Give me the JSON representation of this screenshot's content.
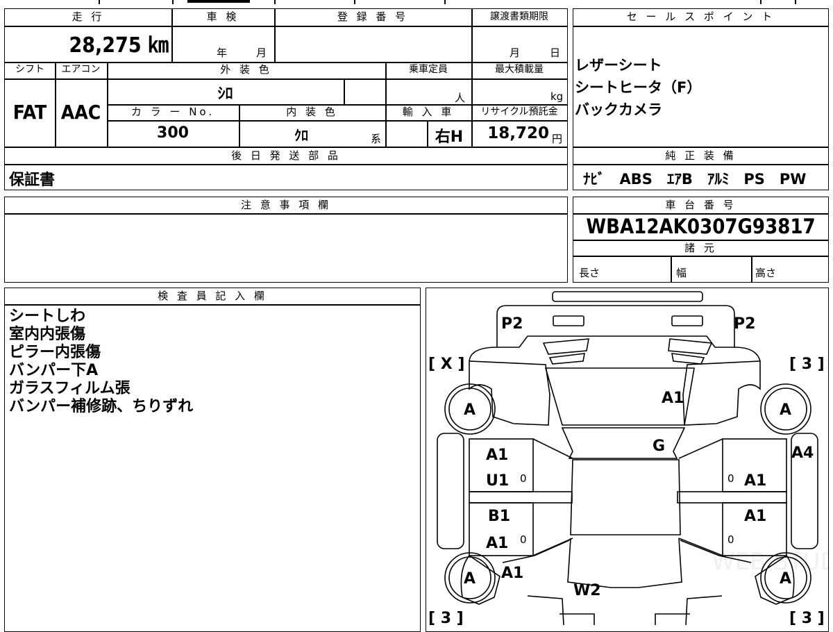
{
  "vehicle": {
    "mileage_header": "走 行",
    "mileage": "28,275 ㎞",
    "inspection_header": "車 検",
    "inspection_year_unit": "年",
    "inspection_month_unit": "月",
    "registration_header": "登 録 番 号",
    "transfer_deadline_header": "譲渡書類期限",
    "transfer_month_unit": "月",
    "transfer_day_unit": "日",
    "shift_header": "シフト",
    "shift": "FAT",
    "aircon_header": "エアコン",
    "aircon": "AAC",
    "exterior_color_header": "外 装 色",
    "exterior_color": "ｼﾛ",
    "capacity_header": "乗車定員",
    "capacity_unit": "人",
    "max_load_header": "最大積載量",
    "max_load_unit": "kg",
    "color_no_header": "カ ラ ー No.",
    "color_no": "300",
    "interior_color_header": "内 装 色",
    "interior_color": "ｸﾛ",
    "interior_color_suffix": "系",
    "import_header": "輸 入 車",
    "import_value": "右H",
    "recycle_header": "リサイクル預託金",
    "recycle_fee": "18,720",
    "recycle_unit": "円",
    "later_parts_header": "後 日 発 送 部 品",
    "later_parts": "保証書",
    "notes_header": "注 意 事 項 欄",
    "inspector_header": "検 査 員 記 入 欄",
    "inspector_notes": [
      "シートしわ",
      "室内内張傷",
      "ピラー内張傷",
      "バンパー下A",
      "ガラスフィルム張",
      "バンパー補修跡、ちりずれ"
    ]
  },
  "sales": {
    "header": "セ ー ル ス ポ イ ン ト",
    "points": [
      "レザーシート",
      "シートヒータ（F）",
      "バックカメラ"
    ],
    "equipment_header": "純 正 装 備",
    "equipment": "ﾅﾋﾞ　ABS　ｴｱB　ｱﾙﾐ　PS　PW",
    "chassis_header": "車 台 番 号",
    "chassis_no": "WBA12AK0307G93817",
    "specs_header": "諸 元",
    "length_label": "長さ",
    "width_label": "幅",
    "height_label": "高さ"
  },
  "diagram": {
    "marks": {
      "p2_left": "P2",
      "p2_right": "P2",
      "x_left": "[ X ]",
      "r3_top": "[ 3 ]",
      "r3_bl": "[ 3 ]",
      "r3_br": "[ 3 ]",
      "tire_fl": "A",
      "tire_fr": "A",
      "tire_rl": "A",
      "tire_rr": "A",
      "hood": "A1",
      "windshield": "G",
      "right_pillar": "A4",
      "fl_door_1": "A1",
      "fl_door_2": "U1",
      "fr_door": "A1",
      "rl_door_1": "B1",
      "rl_door_2": "A1",
      "rr_door": "A1",
      "rear_fender_l": "A1",
      "rear_glass": "W2",
      "zero_1": "0",
      "zero_2": "0",
      "zero_3": "0",
      "zero_4": "0"
    },
    "watermark": "WEB STUDIO R"
  }
}
